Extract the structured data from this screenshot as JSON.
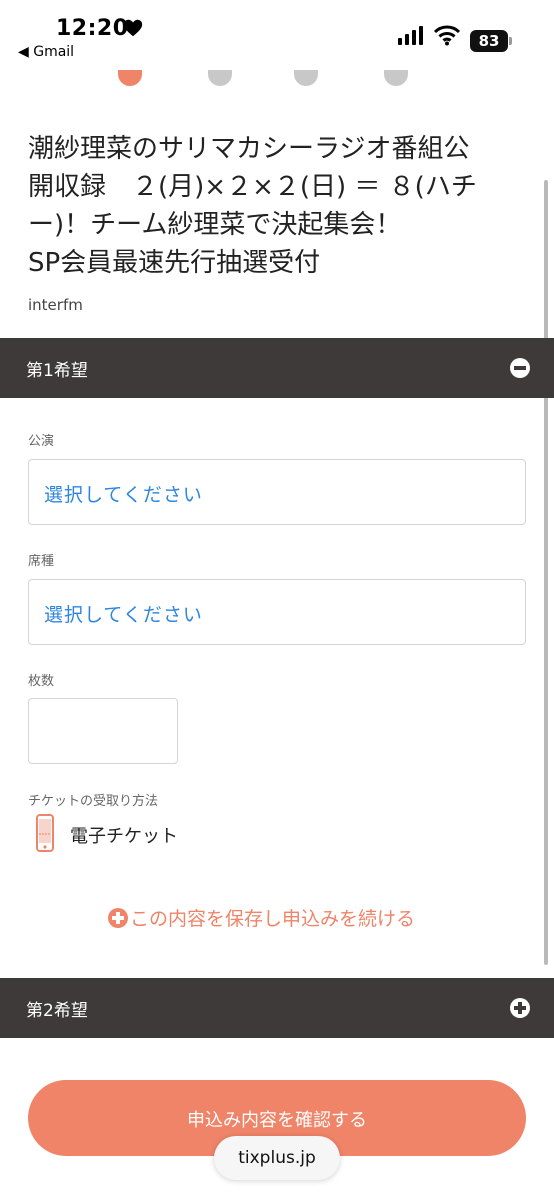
{
  "status_bar": {
    "time": "12:20",
    "back_app": "◀ Gmail",
    "battery": "83"
  },
  "event": {
    "title_lines": [
      "潮紗理菜のサリマカシーラジオ番組公",
      "開収録　２(月)×２×２(日) ＝ ８(ハチ",
      "ー)！チーム紗理菜で決起集会！",
      "SP会員最速先行抽選受付"
    ],
    "organizer": "interfm"
  },
  "choice1": {
    "header": "第1希望",
    "performance_label": "公演",
    "performance_value": "選択してください",
    "seat_label": "席種",
    "seat_value": "選択してください",
    "quantity_label": "枚数",
    "quantity_value": "",
    "delivery_label": "チケットの受取り方法",
    "delivery_method": "電子チケット",
    "save_link": "この内容を保存し申込みを続ける"
  },
  "choice2": {
    "header": "第2希望"
  },
  "confirm_button": "申込み内容を確認する",
  "browser_url": "tixplus.jp",
  "colors": {
    "accent": "#ef8468",
    "section_bar": "#3e3a39",
    "select_text": "#2f86e0"
  },
  "icons": [
    "heart-icon",
    "signal-icon",
    "wifi-icon",
    "minus-circle-icon",
    "plus-circle-icon",
    "smartphone-icon"
  ]
}
